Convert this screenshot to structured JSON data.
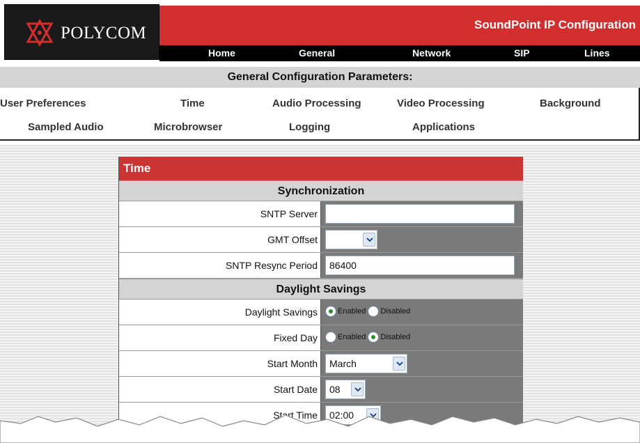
{
  "brand": {
    "logo_text": "POLYCOM",
    "app_title": "SoundPoint IP Configuration"
  },
  "nav": [
    "Home",
    "General",
    "Network",
    "SIP",
    "Lines"
  ],
  "general": {
    "header": "General Configuration Parameters:",
    "links_row1": [
      "User Preferences",
      "Time",
      "Audio Processing",
      "Video Processing",
      "Background"
    ],
    "links_row2": [
      "Sampled Audio",
      "Microbrowser",
      "Logging",
      "Applications"
    ]
  },
  "panel": {
    "title": "Time",
    "synchronization": {
      "header": "Synchronization",
      "sntp_server": {
        "label": "SNTP Server",
        "value": ""
      },
      "gmt_offset": {
        "label": "GMT Offset",
        "value": ""
      },
      "sntp_resync": {
        "label": "SNTP Resync Period",
        "value": "86400"
      }
    },
    "daylight": {
      "header": "Daylight Savings",
      "daylight_savings": {
        "label": "Daylight Savings",
        "enabled_label": "Enabled",
        "disabled_label": "Disabled",
        "selected": "Enabled"
      },
      "fixed_day": {
        "label": "Fixed Day",
        "enabled_label": "Enabled",
        "disabled_label": "Disabled",
        "selected": "Disabled"
      },
      "start_month": {
        "label": "Start Month",
        "value": "March"
      },
      "start_date": {
        "label": "Start Date",
        "value": "08"
      },
      "start_time": {
        "label": "Start Time",
        "value": "02:00"
      }
    }
  },
  "colors": {
    "brand_red": "#d22e2e",
    "panel_red": "#cc3333",
    "nav_black": "#000000",
    "section_gray": "#d4d4d4"
  }
}
